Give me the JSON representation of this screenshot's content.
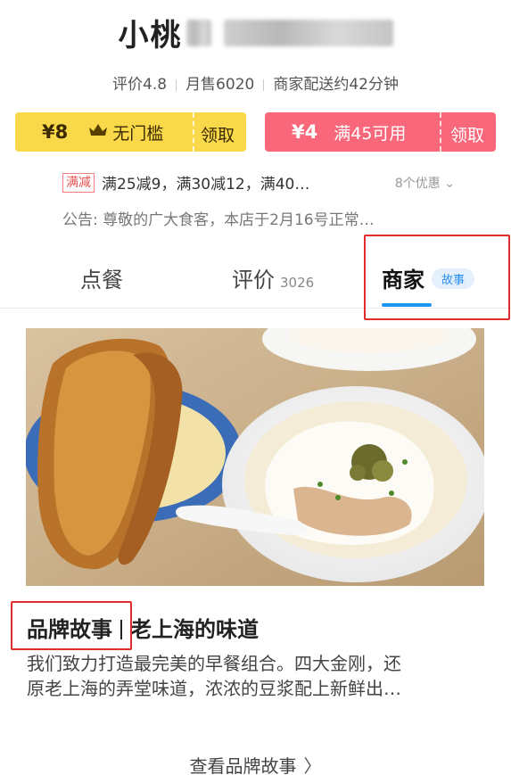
{
  "store": {
    "name_visible": "小桃"
  },
  "stats": {
    "rating": "评价4.8",
    "monthly_sales": "月售6020",
    "delivery": "商家配送约42分钟"
  },
  "coupons": [
    {
      "amount": "¥8",
      "icon": "crown-icon",
      "desc": "无门槛",
      "action": "领取",
      "color": "#f9d94a"
    },
    {
      "amount": "¥4",
      "desc": "满45可用",
      "action": "领取",
      "color": "#f9687a"
    }
  ],
  "promo": {
    "tag": "满减",
    "text": "满25减9，满30减12，满40…",
    "count": "8个优惠"
  },
  "notice": "公告: 尊敬的广大食客，本店于2月16号正常…",
  "tabs": {
    "order": "点餐",
    "reviews": "评价",
    "review_count": "3026",
    "merchant": "商家",
    "merchant_badge": "故事"
  },
  "story": {
    "title_main": "品牌故事",
    "title_sub": "老上海的味道",
    "body_line1": "我们致力打造最完美的早餐组合。四大金刚，还",
    "body_line2": "原老上海的弄堂味道，浓浓的豆浆配上新鲜出…",
    "more": "查看品牌故事"
  },
  "colors": {
    "accent_blue": "#1d95f3",
    "coupon_yellow": "#f9d94a",
    "coupon_red": "#f9687a",
    "highlight_red": "#e22b2b"
  }
}
